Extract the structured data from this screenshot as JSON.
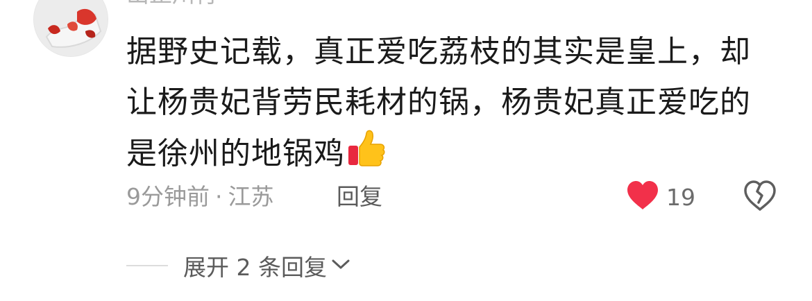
{
  "comment": {
    "username": "山止川行",
    "text": "据野史记载，真正爱吃荔枝的其实是皇上，却让杨贵妃背劳民耗材的锅，杨贵妃真正爱吃的是徐州的地锅鸡",
    "emoji": "thumbs-up-emoji",
    "time": "9分钟前",
    "separator": "·",
    "location": "江苏",
    "reply_label": "回复",
    "likes": "19",
    "like_color": "#f2304a"
  },
  "expand": {
    "label": "展开 2 条回复"
  }
}
